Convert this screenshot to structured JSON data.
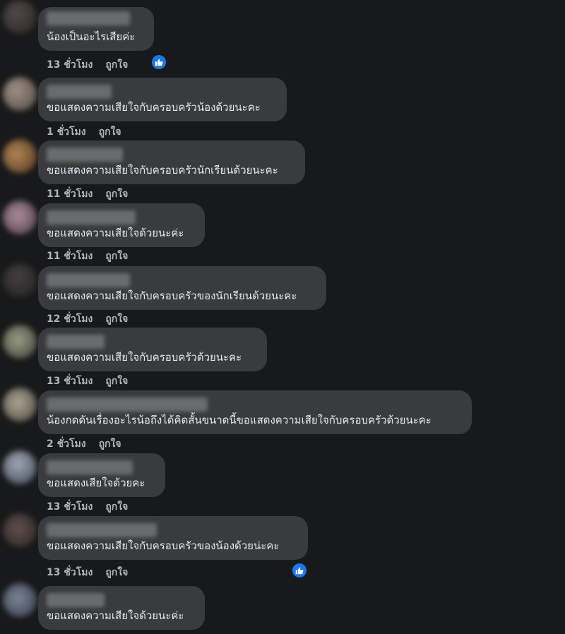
{
  "ui": {
    "like_label": "ถูกใจ",
    "colors": {
      "background": "#18191a",
      "bubble": "#3a3b3c",
      "meta_text": "#b0b3b8",
      "like_reaction": "#1877f2"
    }
  },
  "comments": [
    {
      "text": "น้องเป็นอะไรเสียค่ะ",
      "time": "13 ชั่วโมง",
      "liked": true
    },
    {
      "text": "ขอแสดงความเสียใจกับครอบครัวน้องด้วยนะคะ",
      "time": "1 ชั่วโมง",
      "liked": false
    },
    {
      "text": "ขอแสดงความเสียใจกับครอบครัวนักเรียนด้วยนะคะ",
      "time": "11 ชั่วโมง",
      "liked": false
    },
    {
      "text": "ขอแสดงความเสียใจด้วยนะค่ะ",
      "time": "11 ชั่วโมง",
      "liked": false
    },
    {
      "text": "ขอแสดงความเสียใจกับครอบครัวของนักเรียนด้วยนะคะ",
      "time": "12 ชั่วโมง",
      "liked": false
    },
    {
      "text": "ขอแสดงความเสียใจกับครอบครัวด้วยนะคะ",
      "time": "13 ชั่วโมง",
      "liked": false
    },
    {
      "text": "น้องกดดันเรื่องอะไรน้อถึงได้คิดสั้นขนาดนี้ขอแสดงความเสียใจกับครอบครัวด้วยนะคะ",
      "time": "2 ชั่วโมง",
      "liked": false
    },
    {
      "text": "ขอแสดงเสียใจด้วยคะ",
      "time": "13 ชั่วโมง",
      "liked": false
    },
    {
      "text": "ขอแสดงความเสียใจกับครอบครัวของน้องด้วยน่ะคะ",
      "time": "13 ชั่วโมง",
      "liked": true
    },
    {
      "text": "ขอแสดงความเสียใจด้วยนะค่ะ",
      "time": "",
      "liked": false
    }
  ]
}
